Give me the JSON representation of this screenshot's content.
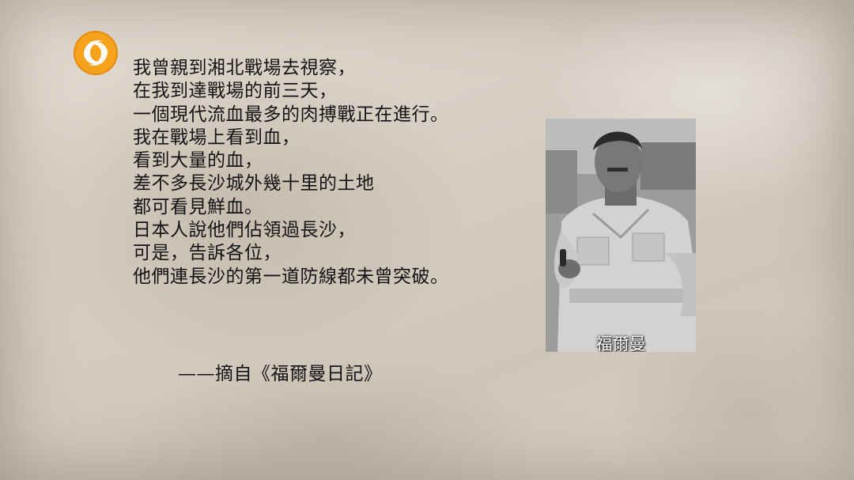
{
  "quote": {
    "lines": [
      "我曾親到湘北戰場去視察，",
      "在我到達戰場的前三天，",
      "一個現代流血最多的肉搏戰正在進行。",
      "我在戰場上看到血，",
      "看到大量的血，",
      "差不多長沙城外幾十里的土地",
      "都可看見鮮血。",
      "日本人說他們佔領過長沙，",
      "可是，告訴各位，",
      "他們連長沙的第一道防線都未曾突破。"
    ],
    "source": "——摘自《福爾曼日記》"
  },
  "photo": {
    "caption": "福爾曼"
  },
  "logo": {
    "icon": "phoenix-logo-icon",
    "color": "#f2a21b"
  }
}
